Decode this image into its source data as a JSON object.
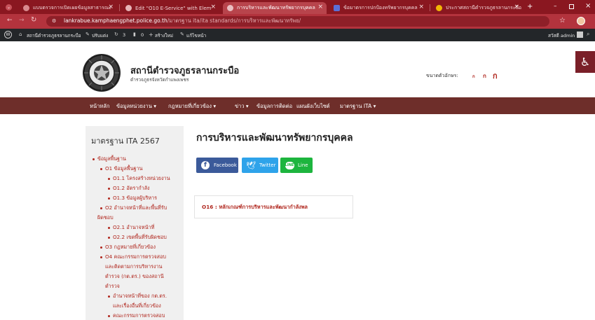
{
  "browser": {
    "tabs": [
      {
        "title": "แบบตรวจการเปิดเผยข้อมูลสาธารณะ",
        "active": false
      },
      {
        "title": "Edit \"O10 E-Service\" with Elem",
        "active": false
      },
      {
        "title": "การบริหารและพัฒนาทรัพยากรบุคคล",
        "active": true
      },
      {
        "title": "ข้อมาตรการปกป้องทรัพยากรบุคคล",
        "active": false
      },
      {
        "title": "ประกาศสถานีตำรวจภูธรลานกระบือ",
        "active": false
      }
    ],
    "new_tab_label": "+",
    "url_host": "lankrabue.kamphaengphet.police.go.th",
    "url_path": "/มาตรฐาน ita/ita standards/การบริหารและพัฒนาทรัพย/"
  },
  "wp_admin_bar": {
    "site_name": "สถานีตำรวจภูธรลานกระบือ",
    "customize_label": "ปรับแต่ง",
    "updates_count": "3",
    "comments_count": "0",
    "new_label": "สร้างใหม่",
    "edit_label": "แก้ไขหน้า",
    "howdy": "สวัสดี admin"
  },
  "header": {
    "site_title": "สถานีตำรวจภูธรลานกระบือ",
    "site_subtitle": "ตำรวจภูธรจังหวัดกำแพงเพชร",
    "font_size_label": "ขนาดตัวอักษร:",
    "font_size_options": [
      "ก",
      "ก",
      "ก"
    ]
  },
  "menu": {
    "items": [
      "หน้าหลัก",
      "ข้อมูลหน่วยงาน ▾",
      "กฎหมายที่เกี่ยวข้อง ▾",
      "ข่าว ▾",
      "ข้อมูลการติดต่อ",
      "แผนผังเว็บไซต์",
      "มาตรฐาน ITA ▾"
    ]
  },
  "sidebar": {
    "title": "มาตรฐาน ITA 2567",
    "lines": [
      "ข้อมูลพื้นฐาน",
      "O1 ข้อมูลพื้นฐาน",
      "O1.1 โครงสร้างหน่วยงาน",
      "O1.2 อัตรากำลัง",
      "O1.3 ข้อมูลผู้บริหาร",
      "O2 อำนาจหน้าที่และพื้นที่รับ",
      "ผิดชอบ",
      "O2.1 อำนาจหน้าที่",
      "O2.2 เขตพื้นที่รับผิดชอบ",
      "O3 กฎหมายที่เกี่ยวข้อง",
      "O4 คณะกรรมการตรวจสอบ",
      "และติดตามการบริหารงาน",
      "ตำรวจ (กต.ตร.) ของสถานี",
      "ตำรวจ",
      "อำนาจหน้าที่ของ กต.ตร.",
      "และเรื่องอื่นที่เกี่ยวข้อง",
      "คณะกรรมการตรวจสอบ"
    ]
  },
  "main": {
    "page_title": "การบริหารและพัฒนาทรัพยากรบุคคล",
    "share": {
      "facebook": "Facebook",
      "twitter": "Twitter",
      "line": "Line"
    },
    "doc_link": "O16 : หลักเกณฑ์การบริหารและพัฒนากำลังพล"
  }
}
